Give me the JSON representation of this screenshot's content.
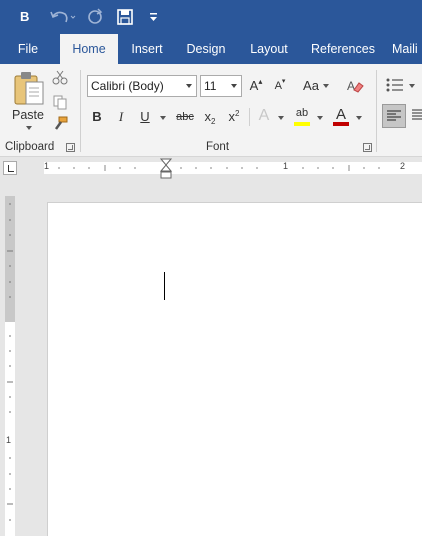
{
  "quick_access": {
    "logo": "B",
    "undo_icon": "undo-icon",
    "redo_icon": "redo-icon",
    "save_icon": "save-icon",
    "customize_icon": "customize-icon"
  },
  "tabs": [
    {
      "label": "File"
    },
    {
      "label": "Home"
    },
    {
      "label": "Insert"
    },
    {
      "label": "Design"
    },
    {
      "label": "Layout"
    },
    {
      "label": "References"
    },
    {
      "label": "Maili"
    }
  ],
  "clipboard": {
    "paste_label": "Paste",
    "group_label": "Clipboard"
  },
  "font": {
    "family": "Calibri (Body)",
    "size": "11",
    "grow": "A",
    "shrink": "A",
    "change_case": "Aa",
    "bold": "B",
    "italic": "I",
    "underline": "U",
    "strike": "abc",
    "subscript": "x",
    "superscript": "x",
    "subscript_mark": "2",
    "superscript_mark": "2",
    "effects": "A",
    "highlight": "ab",
    "font_color": "A",
    "group_label": "Font"
  },
  "ruler": {
    "numbers": [
      "1",
      "1",
      "2"
    ]
  },
  "vruler": {
    "number": "1"
  },
  "colors": {
    "brand": "#2b579a",
    "highlight": "#ffff00",
    "font_color": "#c00000"
  }
}
